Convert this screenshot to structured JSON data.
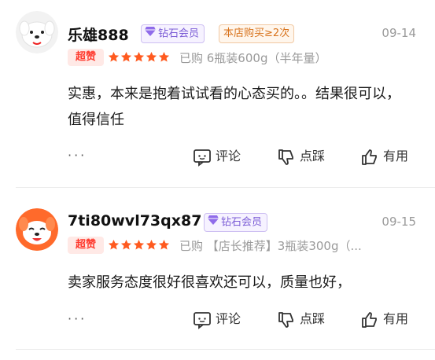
{
  "reviews": [
    {
      "username": "乐雄888",
      "membership": "钻石会员",
      "repeat_badge": "本店购买≥2次",
      "date": "09-14",
      "tag": "超赞",
      "rating": 5,
      "purchase": "已购 6瓶装600g（半年量）",
      "content": "实惠，本来是抱着试试看的心态买的。。结果很可以，值得信任",
      "more": "···",
      "comment_label": "评论",
      "dislike_label": "点踩",
      "useful_label": "有用"
    },
    {
      "username": "7ti80wvl73qx87",
      "membership": "钻石会员",
      "date": "09-15",
      "tag": "超赞",
      "rating": 5,
      "purchase": "已购 【店长推荐】3瓶装300g（...",
      "content": "卖家服务态度很好很喜欢还可以，质量也好，",
      "more": "···",
      "comment_label": "评论",
      "dislike_label": "点踩",
      "useful_label": "有用"
    }
  ],
  "colors": {
    "star": "#ff5a1f",
    "super_bg": "#ffe9e6",
    "super_text": "#ff3b2f",
    "diamond": "#7b5cd6",
    "repeat": "#d8731c",
    "avatar2_bg": "#ff6a2b"
  },
  "icons": {
    "membership": "diamond-icon",
    "star": "star-icon",
    "comment": "comment-icon",
    "dislike": "thumbs-down-icon",
    "useful": "thumbs-up-icon"
  }
}
